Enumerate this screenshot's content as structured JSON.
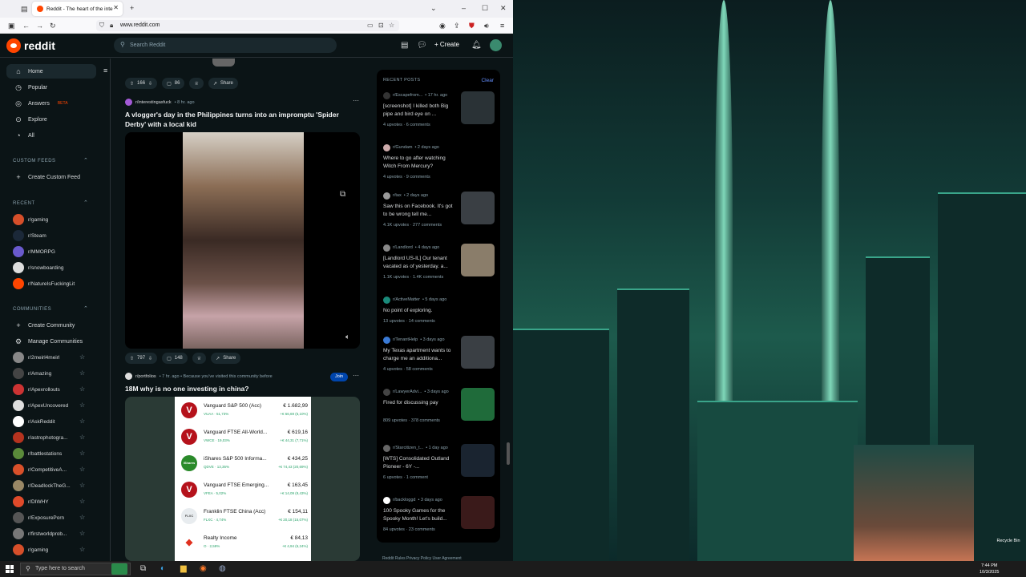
{
  "browser": {
    "tab_title": "Reddit - The heart of the inte",
    "url_domain": "www.reddit.com"
  },
  "header": {
    "brand": "reddit",
    "search_placeholder": "Search Reddit",
    "create_label": "Create"
  },
  "sidebar": {
    "nav": [
      {
        "label": "Home",
        "icon": "home-icon"
      },
      {
        "label": "Popular",
        "icon": "popular-icon"
      },
      {
        "label": "Answers",
        "icon": "answers-icon",
        "badge": "BETA"
      },
      {
        "label": "Explore",
        "icon": "explore-icon"
      },
      {
        "label": "All",
        "icon": "all-icon"
      }
    ],
    "custom_feeds_heading": "CUSTOM FEEDS",
    "create_custom_feed": "Create Custom Feed",
    "recent_heading": "RECENT",
    "recent": [
      "r/gaming",
      "r/Steam",
      "r/MMORPG",
      "r/snowboarding",
      "r/NatureIsFuckingLit"
    ],
    "communities_heading": "COMMUNITIES",
    "create_community": "Create Community",
    "manage_communities": "Manage Communities",
    "communities": [
      "r/2meirl4meirl",
      "r/Amazing",
      "r/Apexrollouts",
      "r/ApexUncovered",
      "r/AskReddit",
      "r/astrophotogra...",
      "r/battlestations",
      "r/CompetitiveA...",
      "r/DeadlockTheG...",
      "r/DIWHY",
      "r/ExposurePorn",
      "r/firstworldprob...",
      "r/gaming"
    ]
  },
  "feed": {
    "post0": {
      "upvotes": "166",
      "comments": "86",
      "share": "Share"
    },
    "post1": {
      "subreddit": "r/interestingasfuck",
      "age": "• 8 hr. ago",
      "title": "A vlogger's day in the Philippines turns into an impromptu 'Spider Derby' with a local kid",
      "upvotes": "797",
      "comments": "148",
      "share": "Share"
    },
    "post2": {
      "subreddit": "r/portfolios",
      "age": "• 7 hr. ago • Because you've visited this community before",
      "join": "Join",
      "title": "18M why is no one investing in china?",
      "funds": [
        {
          "name": "Vanguard S&P 500 (Acc)",
          "value": "€ 1.682,99",
          "ticker": "VUAA · 51,73%",
          "change": "+€ 66,69 (6,10%)",
          "icon": "V",
          "color": "#b5121b"
        },
        {
          "name": "Vanguard FTSE All-World...",
          "value": "€ 619,16",
          "ticker": "VWCE · 19,03%",
          "change": "+€ 44,31 (7,71%)",
          "icon": "V",
          "color": "#b5121b"
        },
        {
          "name": "iShares S&P 500 Informa...",
          "value": "€ 434,25",
          "ticker": "QDVE · 13,35%",
          "change": "+€ 74,43 (20,69%)",
          "icon": "iShares",
          "color": "#2a8a2a"
        },
        {
          "name": "Vanguard FTSE Emerging...",
          "value": "€ 163,45",
          "ticker": "VFEA · 5,02%",
          "change": "+€ 14,09 (9,43%)",
          "icon": "V",
          "color": "#b5121b"
        },
        {
          "name": "Franklin FTSE China (Acc)",
          "value": "€ 154,11",
          "ticker": "FLXC · 4,74%",
          "change": "+€ 20,18 (15,07%)",
          "icon": "FLXC",
          "color": "#e8ecef"
        },
        {
          "name": "Realty Income",
          "value": "€ 84,13",
          "ticker": "O · 2,59%",
          "change": "+€ 4,94 (6,24%)",
          "icon": "◆",
          "color": "#ffffff"
        }
      ]
    }
  },
  "recent_posts": {
    "heading": "RECENT POSTS",
    "clear": "Clear",
    "items": [
      {
        "sub": "r/Escapefrom...",
        "age": "• 17 hr. ago",
        "title": "[screenshot] I killed both Big pipe and bird eye on ...",
        "stats": "4 upvotes · 6 comments",
        "thumb": "#2a3236"
      },
      {
        "sub": "r/Gundam",
        "age": "• 2 days ago",
        "title": "Where to go after watching Witch From Mercury?",
        "stats": "4 upvotes · 9 comments",
        "thumb": ""
      },
      {
        "sub": "r/tax",
        "age": "• 2 days ago",
        "title": "Saw this on Facebook. It's got to be wrong tell me...",
        "stats": "4.1K upvotes · 277 comments",
        "thumb": "#3a3f44"
      },
      {
        "sub": "r/Landlord",
        "age": "• 4 days ago",
        "title": "[Landlord US-IL] Our tenant vacated as of yesterday. a...",
        "stats": "1.1K upvotes · 1.4K comments",
        "thumb": "#8a7d6a"
      },
      {
        "sub": "r/ActiveMatter",
        "age": "• 5 days ago",
        "title": "No point of exploring.",
        "stats": "13 upvotes · 14 comments",
        "thumb": ""
      },
      {
        "sub": "r/TenantHelp",
        "age": "• 3 days ago",
        "title": "My Texas apartment wants to charge me an additiona...",
        "stats": "4 upvotes · 58 comments",
        "thumb": "#3a3f44"
      },
      {
        "sub": "r/LawyerAdvi...",
        "age": "• 3 days ago",
        "title": "Fired for discussing pay",
        "stats": "809 upvotes · 378 comments",
        "thumb": "#1f6b3a"
      },
      {
        "sub": "r/Starcitizen_t...",
        "age": "• 1 day ago",
        "title": "[WTS] Consolidated Outland Pioneer - 6Y -...",
        "stats": "6 upvotes · 1 comment",
        "thumb": "#1a2430"
      },
      {
        "sub": "r/backloggd",
        "age": "• 3 days ago",
        "title": "100 Spooky Games for the Spooky Month! Let's build...",
        "stats": "84 upvotes · 23 comments",
        "thumb": "#3a1a1a"
      }
    ],
    "footer": "Reddit Rules  Privacy Policy  User Agreement"
  },
  "desktop": {
    "recycle_bin": "Recycle Bin"
  },
  "taskbar": {
    "search_placeholder": "Type here to search",
    "time": "7:44 PM",
    "date": "10/3/2025"
  }
}
